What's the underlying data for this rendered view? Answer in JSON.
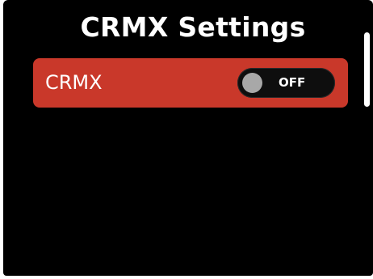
{
  "header": {
    "title": "CRMX Settings"
  },
  "settings": {
    "items": [
      {
        "label": "CRMX",
        "toggle_state": "OFF",
        "highlighted": true
      }
    ]
  },
  "colors": {
    "background": "#000000",
    "highlight": "#c9382a",
    "text": "#ffffff",
    "toggle_track": "#0e0e0e",
    "toggle_knob": "#a8a8a8"
  }
}
